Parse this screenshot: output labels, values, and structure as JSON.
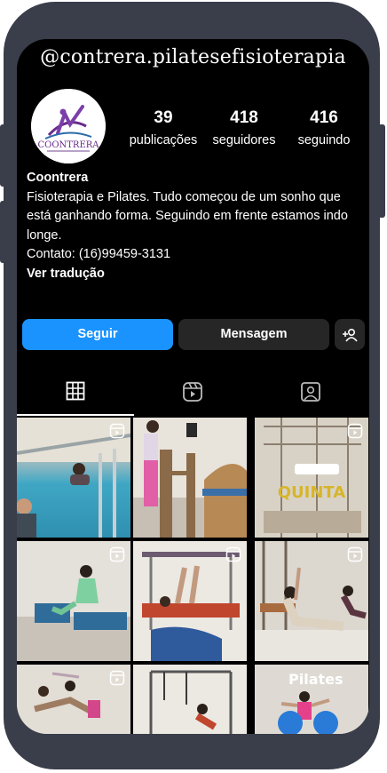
{
  "profile": {
    "handle": "@contrera.pilatesefisioterapia",
    "logo_text": "COONTRERA",
    "stats": [
      {
        "value": "39",
        "label": "publicações"
      },
      {
        "value": "418",
        "label": "seguidores"
      },
      {
        "value": "416",
        "label": "seguindo"
      }
    ],
    "name": "Coontrera",
    "bio_line1": "Fisioterapia e Pilates. Tudo começou de um sonho que está ganhando forma. Seguindo em frente estamos indo longe.",
    "contact": "Contato: (16)99459-3131",
    "translate": "Ver tradução"
  },
  "actions": {
    "follow_label": "Seguir",
    "message_label": "Mensagem"
  },
  "tabs": [
    {
      "icon": "grid-icon",
      "active": true
    },
    {
      "icon": "reels-icon",
      "active": false
    },
    {
      "icon": "tagged-icon",
      "active": false
    }
  ],
  "posts": [
    {
      "overlay": ""
    },
    {
      "overlay": ""
    },
    {
      "overlay": "QUINTA"
    },
    {
      "overlay": ""
    },
    {
      "overlay": ""
    },
    {
      "overlay": ""
    },
    {
      "overlay": ""
    },
    {
      "overlay": ""
    },
    {
      "overlay": "Pilates"
    }
  ],
  "colors": {
    "follow": "#1a93ff",
    "secondary_button": "#262626",
    "frame": "#3a3d4a",
    "logo_purple": "#6a2c8c"
  }
}
